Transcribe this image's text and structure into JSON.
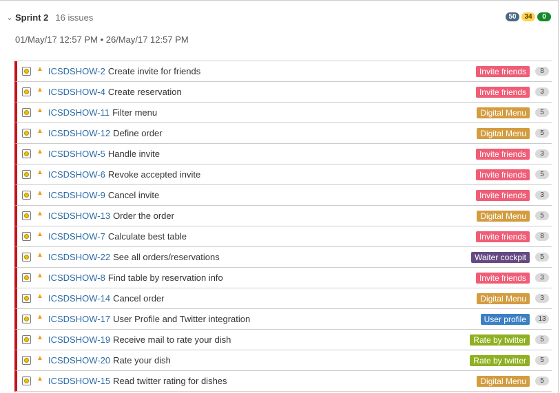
{
  "sprint": {
    "toggle_icon": "chevron-down",
    "name": "Sprint 2",
    "issue_count": "16 issues",
    "dates": "01/May/17 12:57 PM • 26/May/17 12:57 PM",
    "counts": [
      {
        "value": "50",
        "bg": "#4a6785",
        "fg": "#ffffff"
      },
      {
        "value": "34",
        "bg": "#ffd351",
        "fg": "#594300"
      },
      {
        "value": "0",
        "bg": "#14892c",
        "fg": "#ffffff"
      }
    ]
  },
  "colors": {
    "rank_bar": "#c4141a",
    "key_link": "#2b6aa6",
    "priority": "#f09a1b"
  },
  "epic_colors": {
    "Invite friends": "#ef5d76",
    "Digital Menu": "#d39c3f",
    "Waiter cockpit": "#654982",
    "User profile": "#3b7fc4",
    "Rate by twitter": "#8eb021"
  },
  "issues": [
    {
      "key": "ICSDSHOW-2",
      "summary": "Create invite for friends",
      "epic": "Invite friends",
      "points": "8",
      "type_icon": "improvement-icon",
      "priority_icon": "priority-high-icon"
    },
    {
      "key": "ICSDSHOW-4",
      "summary": "Create reservation",
      "epic": "Invite friends",
      "points": "3",
      "type_icon": "improvement-icon",
      "priority_icon": "priority-high-icon"
    },
    {
      "key": "ICSDSHOW-11",
      "summary": "Filter menu",
      "epic": "Digital Menu",
      "points": "5",
      "type_icon": "improvement-icon",
      "priority_icon": "priority-high-icon"
    },
    {
      "key": "ICSDSHOW-12",
      "summary": "Define order",
      "epic": "Digital Menu",
      "points": "5",
      "type_icon": "improvement-icon",
      "priority_icon": "priority-high-icon"
    },
    {
      "key": "ICSDSHOW-5",
      "summary": "Handle invite",
      "epic": "Invite friends",
      "points": "3",
      "type_icon": "improvement-icon",
      "priority_icon": "priority-high-icon"
    },
    {
      "key": "ICSDSHOW-6",
      "summary": "Revoke accepted invite",
      "epic": "Invite friends",
      "points": "5",
      "type_icon": "improvement-icon",
      "priority_icon": "priority-high-icon"
    },
    {
      "key": "ICSDSHOW-9",
      "summary": "Cancel invite",
      "epic": "Invite friends",
      "points": "3",
      "type_icon": "improvement-icon",
      "priority_icon": "priority-high-icon"
    },
    {
      "key": "ICSDSHOW-13",
      "summary": "Order the order",
      "epic": "Digital Menu",
      "points": "5",
      "type_icon": "improvement-icon",
      "priority_icon": "priority-high-icon"
    },
    {
      "key": "ICSDSHOW-7",
      "summary": "Calculate best table",
      "epic": "Invite friends",
      "points": "8",
      "type_icon": "improvement-icon",
      "priority_icon": "priority-high-icon"
    },
    {
      "key": "ICSDSHOW-22",
      "summary": "See all orders/reservations",
      "epic": "Waiter cockpit",
      "points": "5",
      "type_icon": "improvement-icon",
      "priority_icon": "priority-high-icon"
    },
    {
      "key": "ICSDSHOW-8",
      "summary": "Find table by reservation info",
      "epic": "Invite friends",
      "points": "3",
      "type_icon": "improvement-icon",
      "priority_icon": "priority-high-icon"
    },
    {
      "key": "ICSDSHOW-14",
      "summary": "Cancel order",
      "epic": "Digital Menu",
      "points": "3",
      "type_icon": "improvement-icon",
      "priority_icon": "priority-high-icon"
    },
    {
      "key": "ICSDSHOW-17",
      "summary": "User Profile and Twitter integration",
      "epic": "User profile",
      "points": "13",
      "type_icon": "improvement-icon",
      "priority_icon": "priority-high-icon"
    },
    {
      "key": "ICSDSHOW-19",
      "summary": "Receive mail to rate your dish",
      "epic": "Rate by twitter",
      "points": "5",
      "type_icon": "improvement-icon",
      "priority_icon": "priority-high-icon"
    },
    {
      "key": "ICSDSHOW-20",
      "summary": "Rate your dish",
      "epic": "Rate by twitter",
      "points": "5",
      "type_icon": "improvement-icon",
      "priority_icon": "priority-high-icon"
    },
    {
      "key": "ICSDSHOW-15",
      "summary": "Read twitter rating for dishes",
      "epic": "Digital Menu",
      "points": "5",
      "type_icon": "improvement-icon",
      "priority_icon": "priority-high-icon"
    }
  ]
}
